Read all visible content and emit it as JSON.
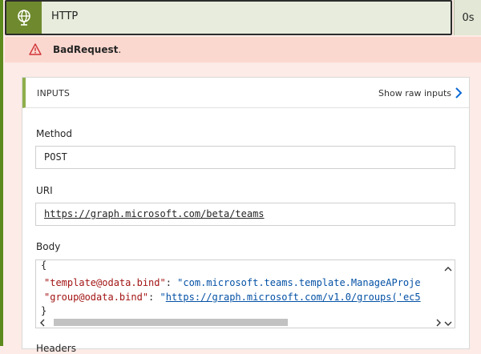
{
  "header": {
    "title": "HTTP",
    "duration": "0s"
  },
  "error": {
    "text": "BadRequest",
    "punct": "."
  },
  "inputs": {
    "title": "INPUTS",
    "raw_link": "Show raw inputs"
  },
  "method": {
    "label": "Method",
    "value": "POST"
  },
  "uri": {
    "label": "URI",
    "value": "https://graph.microsoft.com/beta/teams"
  },
  "body": {
    "label": "Body",
    "open_brace": "{",
    "line1_key": "\"template@odata.bind\"",
    "line1_sep": ": ",
    "line1_value": "\"com.microsoft.teams.template.ManageAProje",
    "line2_key": "\"group@odata.bind\"",
    "line2_sep": ": ",
    "line2_quote": "\"",
    "line2_value": "https://graph.microsoft.com/v1.0/groups('ec5",
    "close_brace": "}"
  },
  "next_section": {
    "label": "Headers"
  },
  "colors": {
    "accent_green": "#6f8a2e",
    "error_bg": "#fbd8cf",
    "link_blue": "#0451a5",
    "warning_red": "#d13438"
  }
}
